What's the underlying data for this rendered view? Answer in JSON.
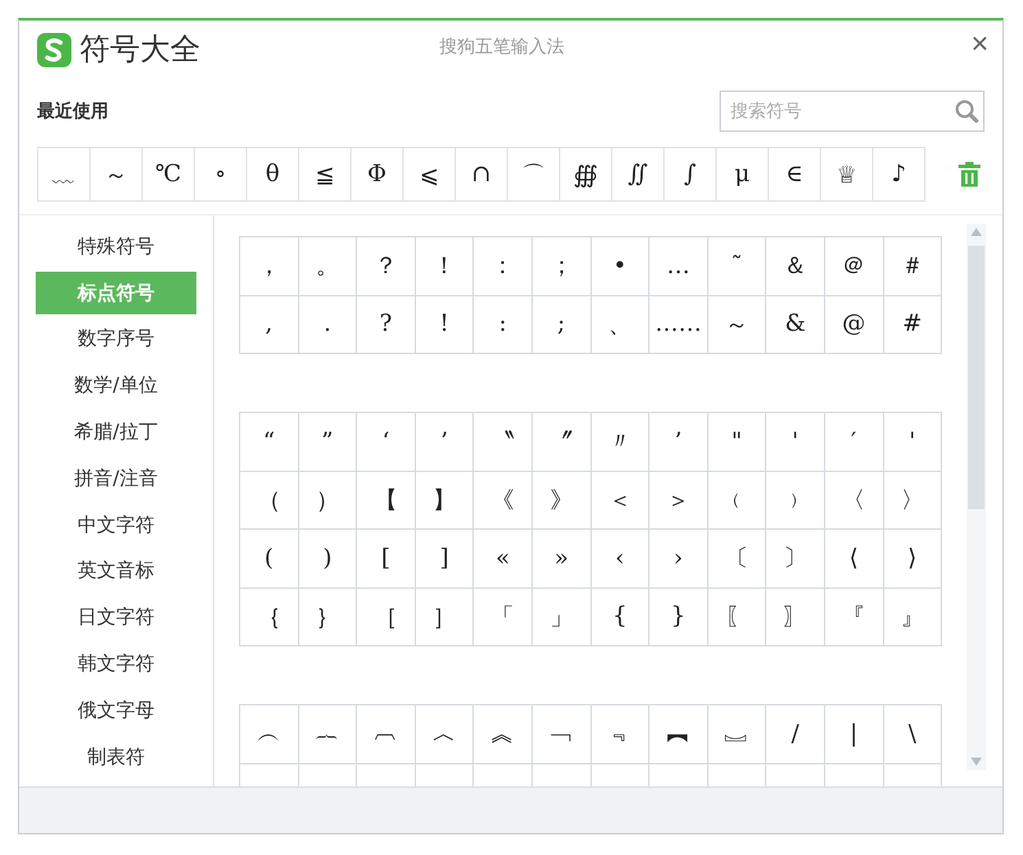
{
  "window": {
    "title": "符号大全",
    "app_name": "搜狗五笔输入法",
    "close": "×"
  },
  "recent": {
    "label": "最近使用",
    "search": {
      "placeholder": "搜索符号"
    },
    "symbols": [
      "﹏",
      "～",
      "℃",
      "∘",
      "θ",
      "≦",
      "Φ",
      "⩽",
      "∩",
      "⌒",
      "∰",
      "∬",
      "∫",
      "μ",
      "∈",
      "♕",
      "♪"
    ]
  },
  "categories": [
    {
      "label": "特殊符号",
      "selected": false
    },
    {
      "label": "标点符号",
      "selected": true
    },
    {
      "label": "数字序号",
      "selected": false
    },
    {
      "label": "数学/单位",
      "selected": false
    },
    {
      "label": "希腊/拉丁",
      "selected": false
    },
    {
      "label": "拼音/注音",
      "selected": false
    },
    {
      "label": "中文字符",
      "selected": false
    },
    {
      "label": "英文音标",
      "selected": false
    },
    {
      "label": "日文字符",
      "selected": false
    },
    {
      "label": "韩文字符",
      "selected": false
    },
    {
      "label": "俄文字母",
      "selected": false
    },
    {
      "label": "制表符",
      "selected": false
    }
  ],
  "sections": [
    {
      "clipped": false,
      "rows": [
        [
          "，",
          "。",
          "？",
          "！",
          "：",
          "；",
          "•",
          "…",
          "˜",
          "＆",
          "＠",
          "＃"
        ],
        [
          ",",
          ".",
          "?",
          "!",
          ":",
          ";",
          "、",
          "……",
          "～",
          "&",
          "@",
          "#"
        ]
      ]
    },
    {
      "clipped": false,
      "rows": [
        [
          "“",
          "”",
          "‘",
          "’",
          "〝",
          "〞",
          "〃",
          "’",
          "\"",
          "'",
          "′",
          "'"
        ],
        [
          "（",
          "）",
          "【",
          "】",
          "《",
          "》",
          "＜",
          "＞",
          "﹙",
          "﹚",
          "〈",
          "〉"
        ],
        [
          "(",
          ")",
          "[",
          "]",
          "«",
          "»",
          "‹",
          "›",
          "〔",
          "〕",
          "⟨",
          "⟩"
        ],
        [
          "｛",
          "｝",
          "［",
          "］",
          "「",
          "」",
          "{",
          "}",
          "〖",
          "〗",
          "『",
          "』"
        ]
      ]
    },
    {
      "clipped": true,
      "rows": [
        [
          "︵",
          "︷",
          "︹",
          "︿",
          "︽",
          "﹁",
          "﹃",
          "︻",
          "︗",
          "/",
          "|",
          "\\"
        ]
      ]
    }
  ]
}
